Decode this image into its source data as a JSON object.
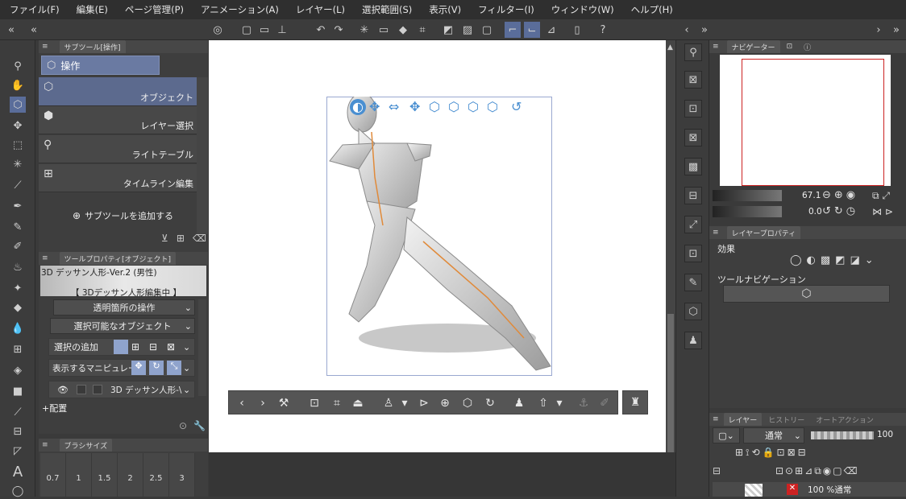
{
  "menu": [
    "ファイル(F)",
    "編集(E)",
    "ページ管理(P)",
    "アニメーション(A)",
    "レイヤー(L)",
    "選択範囲(S)",
    "表示(V)",
    "フィルター(I)",
    "ウィンドウ(W)",
    "ヘルプ(H)"
  ],
  "sub_tool_panel": {
    "tab": "サブツール[操作]",
    "group": "操作",
    "items": [
      "オブジェクト",
      "レイヤー選択",
      "ライトテーブル",
      "タイムライン編集"
    ],
    "add_label": "サブツールを追加する"
  },
  "tool_property": {
    "tab": "ツールプロパティ[オブジェクト]",
    "object_name": "3D デッサン人形-Ver.2 (男性)",
    "editing_label": "【 3Dデッサン人形編集中 】",
    "transparent_op": "透明箇所の操作",
    "selectable_obj": "選択可能なオブジェクト",
    "add_selection": "選択の追加",
    "manipulator": "表示するマニピュレータ",
    "layer_obj": "3D デッサン人形-\\",
    "placement": "+配置"
  },
  "brush_size": {
    "tab": "ブラシサイズ",
    "values": [
      "0.7",
      "1",
      "1.5",
      "2",
      "2.5",
      "3"
    ]
  },
  "navigator": {
    "tab": "ナビゲーター",
    "zoom": "67.1",
    "rotation": "0.0"
  },
  "layer_property": {
    "tab": "レイヤープロパティ",
    "effect": "効果",
    "tool_nav": "ツールナビゲーション"
  },
  "layer_panel": {
    "tabs": [
      "レイヤー",
      "ヒストリー",
      "オートアクション"
    ],
    "blend": "通常",
    "opacity": "100",
    "layer_row": "100 %通常"
  },
  "colors": {
    "accent": "#5a6d9a",
    "manipulator": "#4a8fd1",
    "nav_frame": "#cc2222"
  }
}
